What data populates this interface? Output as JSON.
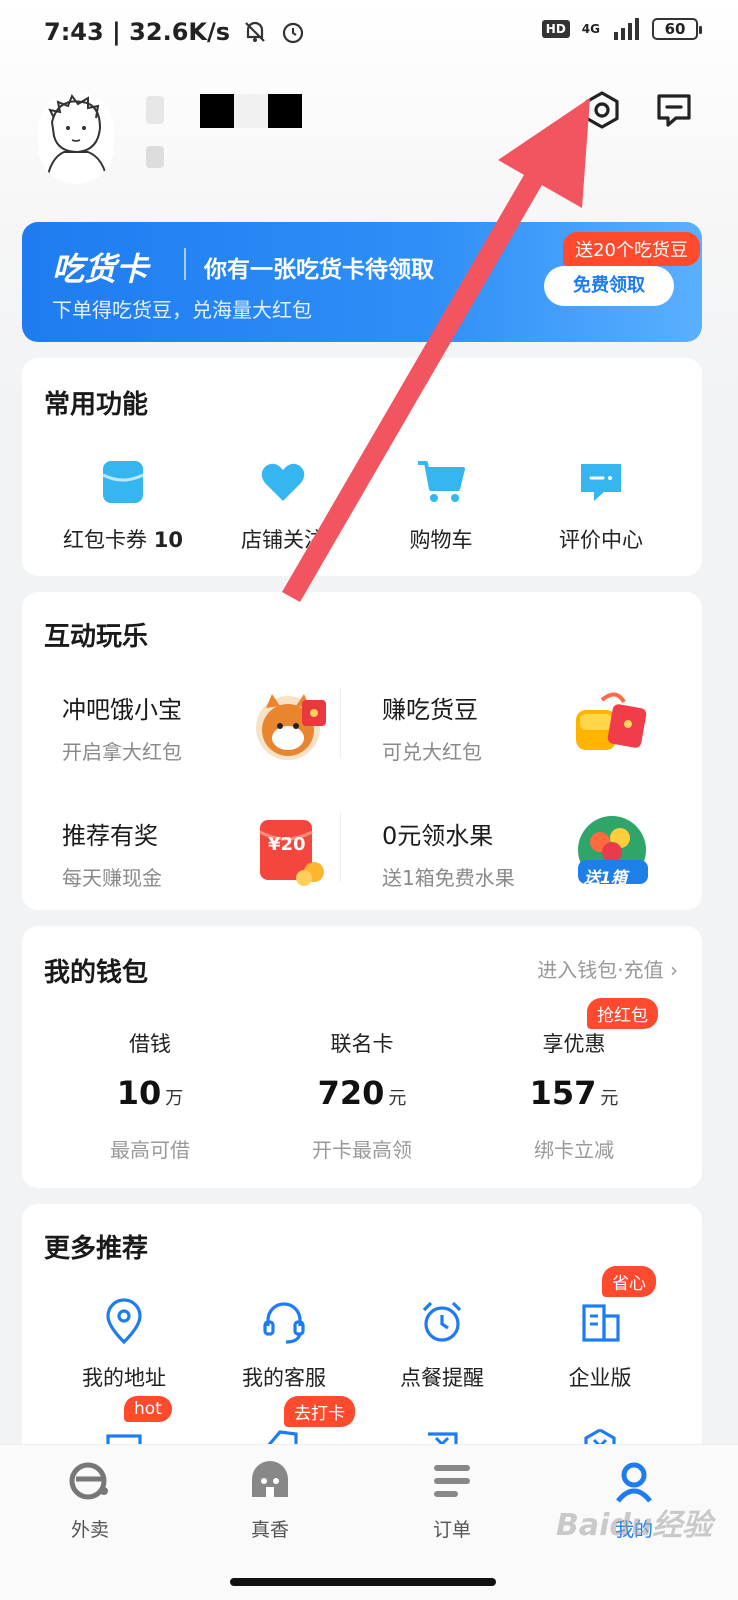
{
  "status_bar": {
    "time_speed": "7:43 | 32.6K/s",
    "hd": "HD",
    "network": "4G",
    "battery": "60"
  },
  "banner": {
    "logo": "吃货卡",
    "title": "你有一张吃货卡待领取",
    "subtitle": "下单得吃货豆，兑海量大红包",
    "tag": "送20个吃货豆",
    "button": "免费领取"
  },
  "common": {
    "title": "常用功能",
    "items": [
      {
        "label": "红包卡券",
        "count": "10"
      },
      {
        "label": "店铺关注"
      },
      {
        "label": "购物车"
      },
      {
        "label": "评价中心"
      }
    ]
  },
  "play": {
    "title": "互动玩乐",
    "items": [
      {
        "title": "冲吧饿小宝",
        "sub": "开启拿大红包"
      },
      {
        "title": "赚吃货豆",
        "sub": "可兑大红包"
      },
      {
        "title": "推荐有奖",
        "sub": "每天赚现金",
        "badge": "¥20"
      },
      {
        "title": "0元领水果",
        "sub": "送1箱免费水果",
        "badge": "送1箱"
      }
    ]
  },
  "wallet": {
    "title": "我的钱包",
    "link": "进入钱包·充值 ›",
    "tag": "抢红包",
    "cols": [
      {
        "label": "借钱",
        "value": "10",
        "unit": "万",
        "desc": "最高可借"
      },
      {
        "label": "联名卡",
        "value": "720",
        "unit": "元",
        "desc": "开卡最高领"
      },
      {
        "label": "享优惠",
        "value": "157",
        "unit": "元",
        "desc": "绑卡立减"
      }
    ]
  },
  "more": {
    "title": "更多推荐",
    "items": [
      {
        "label": "我的地址"
      },
      {
        "label": "我的客服"
      },
      {
        "label": "点餐提醒"
      },
      {
        "label": "企业版",
        "badge": "省心"
      }
    ],
    "row2_badges": {
      "hot": "hot",
      "checkin": "去打卡"
    }
  },
  "nav": {
    "items": [
      {
        "label": "外卖"
      },
      {
        "label": "真香"
      },
      {
        "label": "订单"
      },
      {
        "label": "我的"
      }
    ]
  },
  "watermark": "Baidu经验",
  "colors": {
    "primary_blue": "#1e7cf0",
    "red": "#ff4a2e",
    "arrow": "#f25460"
  }
}
